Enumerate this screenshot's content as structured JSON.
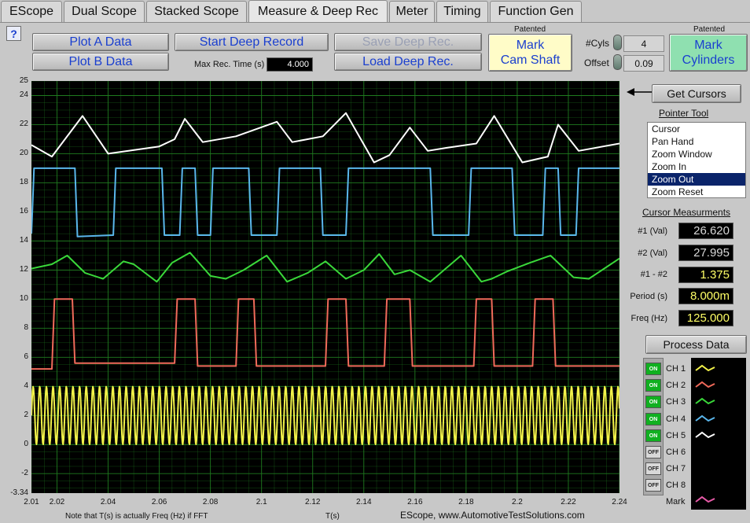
{
  "tabs": [
    {
      "label": "EScope",
      "active": false
    },
    {
      "label": "Dual Scope",
      "active": false
    },
    {
      "label": "Stacked Scope",
      "active": false
    },
    {
      "label": "Measure & Deep Rec",
      "active": true
    },
    {
      "label": "Meter",
      "active": false
    },
    {
      "label": "Timing",
      "active": false
    },
    {
      "label": "Function Gen",
      "active": false
    }
  ],
  "toolbar": {
    "help_label": "?",
    "plot_a_label": "Plot A Data",
    "plot_b_label": "Plot B Data",
    "start_deep_record_label": "Start Deep Record",
    "save_deep_rec_label": "Save Deep Rec.",
    "load_deep_rec_label": "Load Deep Rec.",
    "max_rec_time_label": "Max Rec. Time (s)",
    "max_rec_time_value": "4.000",
    "cam_patented": "Patented",
    "cam_line1": "Mark",
    "cam_line2": "Cam Shaft",
    "cyls_label": "#Cyls",
    "cyls_value": "4",
    "offset_label": "Offset",
    "offset_value": "0.09",
    "cyl_patented": "Patented",
    "cyl_line1": "Mark",
    "cyl_line2": "Cylinders"
  },
  "right_panel": {
    "get_cursors_label": "Get Cursors",
    "pointer_tool_title": "Pointer Tool",
    "pointer_tools": [
      "Cursor",
      "Pan Hand",
      "Zoom Window",
      "Zoom In",
      "Zoom Out",
      "Zoom Reset"
    ],
    "pointer_selected": "Zoom Out",
    "cursor_title": "Cursor Measurments",
    "measurements": [
      {
        "label": "#1 (Val)",
        "value": "26.620",
        "color": "#d8d8d8"
      },
      {
        "label": "#2 (Val)",
        "value": "27.995",
        "color": "#d8d8d8"
      },
      {
        "label": "#1 - #2",
        "value": "1.375",
        "color": "#ffff66"
      },
      {
        "label": "Period (s)",
        "value": "8.000m",
        "color": "#ffff66"
      },
      {
        "label": "Freq (Hz)",
        "value": "125.000",
        "color": "#ffff66"
      }
    ],
    "process_data_label": "Process Data",
    "channels": [
      {
        "state": "ON",
        "label": "CH 1",
        "color": "#f2f24a"
      },
      {
        "state": "ON",
        "label": "CH 2",
        "color": "#f06a5a"
      },
      {
        "state": "ON",
        "label": "CH 3",
        "color": "#3ad83a"
      },
      {
        "state": "ON",
        "label": "CH 4",
        "color": "#5ab6ec"
      },
      {
        "state": "ON",
        "label": "CH 5",
        "color": "#ffffff"
      },
      {
        "state": "OFF",
        "label": "CH 6",
        "color": ""
      },
      {
        "state": "OFF",
        "label": "CH 7",
        "color": ""
      },
      {
        "state": "OFF",
        "label": "CH 8",
        "color": ""
      }
    ],
    "mark_label": "Mark",
    "mark_color": "#e85aa8"
  },
  "footer": {
    "note": "Note that T(s) is actually Freq (Hz) if FFT",
    "x_axis_label": "T(s)",
    "credit": "EScope, www.AutomotiveTestSolutions.com"
  },
  "chart_data": {
    "type": "line",
    "xlabel": "T(s)",
    "xlim": [
      2.01,
      2.24
    ],
    "ylim": [
      -3.34,
      25
    ],
    "x_ticks": [
      "2.01",
      "2.02",
      "2.04",
      "2.06",
      "2.08",
      "2.1",
      "2.12",
      "2.14",
      "2.16",
      "2.18",
      "2.2",
      "2.22",
      "2.24"
    ],
    "x_tick_values": [
      2.01,
      2.02,
      2.04,
      2.06,
      2.08,
      2.1,
      2.12,
      2.14,
      2.16,
      2.18,
      2.2,
      2.22,
      2.24
    ],
    "y_ticks": [
      "25",
      "24",
      "22",
      "20",
      "18",
      "16",
      "14",
      "12",
      "10",
      "8",
      "6",
      "4",
      "2",
      "0",
      "-2",
      "-3.34"
    ],
    "y_tick_values": [
      25,
      24,
      22,
      20,
      18,
      16,
      14,
      12,
      10,
      8,
      6,
      4,
      2,
      0,
      -2,
      -3.34
    ],
    "grid": true,
    "background": "#000000",
    "grid_color": "#1f7a1f",
    "series": [
      {
        "color": "#ffffff",
        "values": [
          [
            2.01,
            20.6
          ],
          [
            2.018,
            19.8
          ],
          [
            2.03,
            22.6
          ],
          [
            2.04,
            20.0
          ],
          [
            2.06,
            20.5
          ],
          [
            2.066,
            21.0
          ],
          [
            2.07,
            22.4
          ],
          [
            2.077,
            20.8
          ],
          [
            2.09,
            21.2
          ],
          [
            2.106,
            22.2
          ],
          [
            2.112,
            20.8
          ],
          [
            2.124,
            21.2
          ],
          [
            2.133,
            22.8
          ],
          [
            2.144,
            19.4
          ],
          [
            2.15,
            19.9
          ],
          [
            2.158,
            21.8
          ],
          [
            2.165,
            20.2
          ],
          [
            2.172,
            20.4
          ],
          [
            2.184,
            20.7
          ],
          [
            2.191,
            22.6
          ],
          [
            2.202,
            19.4
          ],
          [
            2.212,
            19.8
          ],
          [
            2.216,
            22.0
          ],
          [
            2.224,
            20.2
          ],
          [
            2.24,
            20.7
          ]
        ]
      },
      {
        "color": "#5ab6ec",
        "values": [
          [
            2.01,
            14.5
          ],
          [
            2.011,
            19.0
          ],
          [
            2.027,
            19.0
          ],
          [
            2.028,
            14.3
          ],
          [
            2.042,
            14.4
          ],
          [
            2.043,
            19.0
          ],
          [
            2.061,
            19.0
          ],
          [
            2.062,
            14.4
          ],
          [
            2.068,
            14.4
          ],
          [
            2.069,
            19.0
          ],
          [
            2.074,
            19.0
          ],
          [
            2.075,
            14.4
          ],
          [
            2.08,
            14.4
          ],
          [
            2.081,
            19.0
          ],
          [
            2.095,
            19.0
          ],
          [
            2.096,
            14.4
          ],
          [
            2.106,
            14.4
          ],
          [
            2.107,
            19.0
          ],
          [
            2.123,
            19.0
          ],
          [
            2.124,
            14.4
          ],
          [
            2.133,
            14.4
          ],
          [
            2.134,
            19.0
          ],
          [
            2.166,
            19.0
          ],
          [
            2.167,
            14.4
          ],
          [
            2.181,
            14.4
          ],
          [
            2.182,
            19.0
          ],
          [
            2.198,
            19.0
          ],
          [
            2.199,
            14.4
          ],
          [
            2.21,
            14.4
          ],
          [
            2.211,
            19.0
          ],
          [
            2.216,
            19.0
          ],
          [
            2.217,
            14.4
          ],
          [
            2.223,
            14.4
          ],
          [
            2.224,
            19.0
          ],
          [
            2.24,
            19.0
          ]
        ]
      },
      {
        "color": "#3ad83a",
        "values": [
          [
            2.01,
            12.1
          ],
          [
            2.018,
            12.4
          ],
          [
            2.024,
            13.0
          ],
          [
            2.031,
            11.8
          ],
          [
            2.038,
            11.4
          ],
          [
            2.046,
            12.6
          ],
          [
            2.05,
            12.4
          ],
          [
            2.059,
            11.2
          ],
          [
            2.065,
            12.5
          ],
          [
            2.072,
            13.2
          ],
          [
            2.08,
            11.6
          ],
          [
            2.086,
            11.4
          ],
          [
            2.093,
            12.0
          ],
          [
            2.102,
            13.0
          ],
          [
            2.11,
            11.2
          ],
          [
            2.118,
            11.8
          ],
          [
            2.125,
            12.6
          ],
          [
            2.133,
            11.4
          ],
          [
            2.14,
            12.0
          ],
          [
            2.146,
            13.1
          ],
          [
            2.152,
            11.7
          ],
          [
            2.158,
            12.0
          ],
          [
            2.166,
            11.2
          ],
          [
            2.174,
            12.4
          ],
          [
            2.178,
            13.0
          ],
          [
            2.186,
            11.2
          ],
          [
            2.19,
            11.4
          ],
          [
            2.196,
            11.9
          ],
          [
            2.205,
            12.5
          ],
          [
            2.213,
            13.0
          ],
          [
            2.222,
            11.5
          ],
          [
            2.228,
            11.4
          ],
          [
            2.24,
            12.8
          ]
        ]
      },
      {
        "color": "#f06a5a",
        "values": [
          [
            2.01,
            5.2
          ],
          [
            2.018,
            5.2
          ],
          [
            2.019,
            10.0
          ],
          [
            2.026,
            10.0
          ],
          [
            2.027,
            5.6
          ],
          [
            2.066,
            5.6
          ],
          [
            2.067,
            10.0
          ],
          [
            2.074,
            10.0
          ],
          [
            2.075,
            5.4
          ],
          [
            2.09,
            5.4
          ],
          [
            2.091,
            10.0
          ],
          [
            2.097,
            10.0
          ],
          [
            2.098,
            5.4
          ],
          [
            2.125,
            5.4
          ],
          [
            2.126,
            10.0
          ],
          [
            2.133,
            10.0
          ],
          [
            2.134,
            5.4
          ],
          [
            2.148,
            5.4
          ],
          [
            2.149,
            10.0
          ],
          [
            2.158,
            10.0
          ],
          [
            2.159,
            5.4
          ],
          [
            2.183,
            5.4
          ],
          [
            2.184,
            10.0
          ],
          [
            2.19,
            10.0
          ],
          [
            2.191,
            5.4
          ],
          [
            2.206,
            5.4
          ],
          [
            2.207,
            10.0
          ],
          [
            2.214,
            10.0
          ],
          [
            2.215,
            5.4
          ],
          [
            2.24,
            5.4
          ]
        ]
      },
      {
        "color": "#f2f24a",
        "type": "oscillation",
        "center": 2.0,
        "amplitude": 2.0,
        "period": 0.0026
      }
    ]
  }
}
